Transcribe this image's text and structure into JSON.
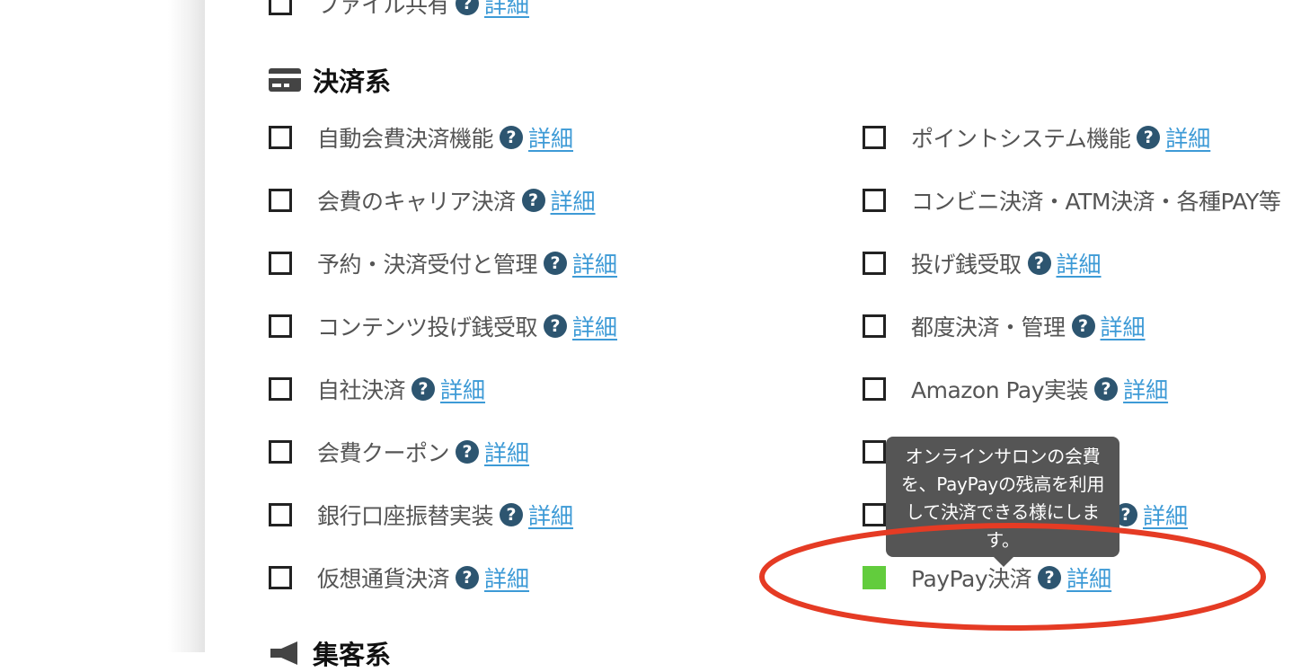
{
  "top_item": {
    "label": "ファイル共有",
    "detail": "詳細"
  },
  "section": {
    "title": "決済系",
    "icon": "credit-card-icon"
  },
  "left_items": [
    {
      "label": "自動会費決済機能",
      "detail": "詳細",
      "checked": false
    },
    {
      "label": "会費のキャリア決済",
      "detail": "詳細",
      "checked": false
    },
    {
      "label": "予約・決済受付と管理",
      "detail": "詳細",
      "checked": false
    },
    {
      "label": "コンテンツ投げ銭受取",
      "detail": "詳細",
      "checked": false
    },
    {
      "label": "自社決済",
      "detail": "詳細",
      "checked": false
    },
    {
      "label": "会費クーポン",
      "detail": "詳細",
      "checked": false
    },
    {
      "label": "銀行口座振替実装",
      "detail": "詳細",
      "checked": false
    },
    {
      "label": "仮想通貨決済",
      "detail": "詳細",
      "checked": false
    }
  ],
  "right_items": [
    {
      "label": "ポイントシステム機能",
      "detail": "詳細",
      "checked": false
    },
    {
      "label": "コンビニ決済・ATM決済・各種PAY等",
      "detail": "",
      "checked": false
    },
    {
      "label": "投げ銭受取",
      "detail": "詳細",
      "checked": false
    },
    {
      "label": "都度決済・管理",
      "detail": "詳細",
      "checked": false
    },
    {
      "label": "Amazon Pay実装",
      "detail": "詳細",
      "checked": false
    },
    {
      "label": "",
      "detail": "",
      "checked": false
    },
    {
      "label": "",
      "detail": "詳細",
      "checked": false
    },
    {
      "label": "PayPay決済",
      "detail": "詳細",
      "checked": true
    }
  ],
  "tooltip": {
    "text": "オンラインサロンの会費を、PayPayの残高を利用して決済できる様にします。"
  },
  "next_section": {
    "title": "集客系",
    "icon": "megaphone-icon"
  },
  "colors": {
    "checked": "#62cc3d",
    "help": "#2d5570",
    "link": "#3d9ad6",
    "tooltip_bg": "#555555",
    "highlight": "#e53b24"
  }
}
